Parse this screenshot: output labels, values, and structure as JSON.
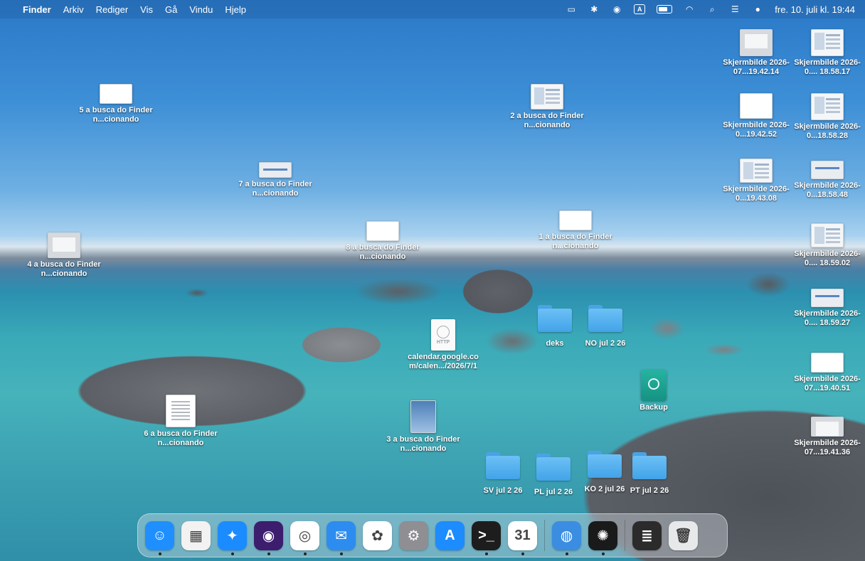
{
  "menubar": {
    "apple": "",
    "app_name": "Finder",
    "menus": [
      "Arkiv",
      "Rediger",
      "Vis",
      "Gå",
      "Vindu",
      "Hjelp"
    ],
    "input_source": "A",
    "clock": "fre. 10. juli kl. 19:44",
    "status_icons": [
      "screen-mirroring-icon",
      "ai-assistant-icon",
      "user-icon",
      "input-source-icon",
      "battery-icon",
      "wifi-icon",
      "search-icon",
      "control-center-icon",
      "siri-icon"
    ]
  },
  "desktop": {
    "files": {
      "f5": "5 a busca do Finder n...cionando",
      "f2": "2 a busca do Finder n...cionando",
      "f7": "7 a busca do Finder n...cionando",
      "f8": "8 a busca do Finder n...cionando",
      "f1": "1 a busca do Finder n...cionando",
      "f4": "4 a busca do Finder n...cionando",
      "f6": "6 a busca do Finder n...cionando",
      "f3": "3 a busca do Finder n...cionando",
      "calendar": "calendar.google.co m/calen.../2026/7/1",
      "calendar_tag": "HTTP"
    },
    "folders": {
      "deks": "deks",
      "no": "NO jul 2 26",
      "sv": "SV jul 2 26",
      "pl": "PL jul 2 26",
      "ko": "KO 2 jul 26",
      "pt": "PT jul 2 26"
    },
    "backup": "Backup",
    "screenshots": [
      "Skjermbilde 2026-07...19.42.14",
      "Skjermbilde 2026-0.... 18.58.17",
      "Skjermbilde 2026-0...19.42.52",
      "Skjermbilde 2026-0...18.58.28",
      "Skjermbilde 2026-0...19.43.08",
      "Skjermbilde 2026-0...18.58.48",
      "Skjermbilde 2026-0.... 18.59.02",
      "Skjermbilde 2026-0.... 18.59.27",
      "Skjermbilde 2026-07...19.40.51",
      "Skjermbilde 2026-07...19.41.36"
    ]
  },
  "dock": {
    "apps": [
      {
        "name": "Finder",
        "icon": "finder-icon",
        "color": "#1f8fff",
        "glyph": "☺"
      },
      {
        "name": "Launchpad",
        "icon": "launchpad-icon",
        "color": "#f2f2f2",
        "glyph": "▦"
      },
      {
        "name": "Safari",
        "icon": "safari-icon",
        "color": "#1b8cff",
        "glyph": "✦"
      },
      {
        "name": "Firefox",
        "icon": "firefox-icon",
        "color": "#3c1d6e",
        "glyph": "◉"
      },
      {
        "name": "Chrome",
        "icon": "chrome-icon",
        "color": "#ffffff",
        "glyph": "◎"
      },
      {
        "name": "Mail",
        "icon": "mail-icon",
        "color": "#2d8cf0",
        "glyph": "✉"
      },
      {
        "name": "Photos",
        "icon": "photos-icon",
        "color": "#ffffff",
        "glyph": "✿"
      },
      {
        "name": "System Settings",
        "icon": "system-settings-icon",
        "color": "#8e8e93",
        "glyph": "⚙"
      },
      {
        "name": "App Store",
        "icon": "app-store-icon",
        "color": "#1c8cff",
        "glyph": "A"
      },
      {
        "name": "Terminal",
        "icon": "terminal-icon",
        "color": "#1d1d1d",
        "glyph": ">_"
      },
      {
        "name": "Calendar",
        "icon": "calendar-icon",
        "color": "#ffffff",
        "glyph": "31"
      },
      {
        "name": "Backup App",
        "icon": "backup-app-icon",
        "color": "#3a8de0",
        "glyph": "◍"
      },
      {
        "name": "ChatGPT",
        "icon": "chatgpt-icon",
        "color": "#1a1a1a",
        "glyph": "✺"
      },
      {
        "name": "Documents Stack",
        "icon": "stack-icon",
        "color": "#2b2b2b",
        "glyph": "≣"
      },
      {
        "name": "Trash",
        "icon": "trash-icon",
        "color": "#e6e8ea",
        "glyph": "🗑"
      }
    ]
  }
}
